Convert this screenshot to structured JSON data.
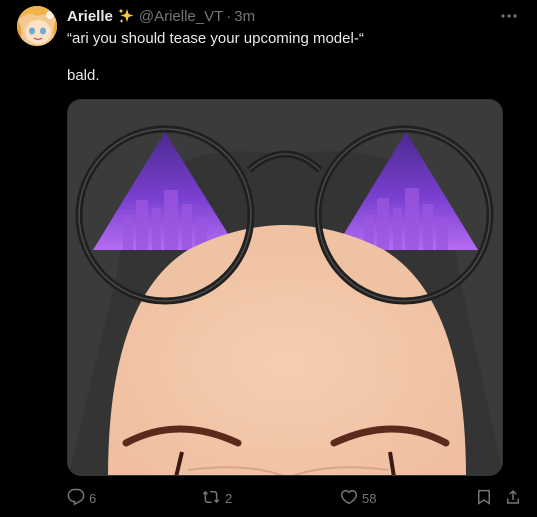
{
  "author": {
    "name": "Arielle",
    "handle": "@Arielle_VT",
    "separator": "·",
    "time": "3m",
    "badge_icon": "sparkles-icon"
  },
  "post": {
    "line1": "“ari you should tease your upcoming model-“",
    "line2": "bald."
  },
  "actions": {
    "reply_count": "6",
    "retweet_count": "2",
    "like_count": "58"
  },
  "colors": {
    "background": "#000000",
    "text": "#e7e9ea",
    "muted": "#71767b",
    "sparkle": "#ffc83d"
  }
}
